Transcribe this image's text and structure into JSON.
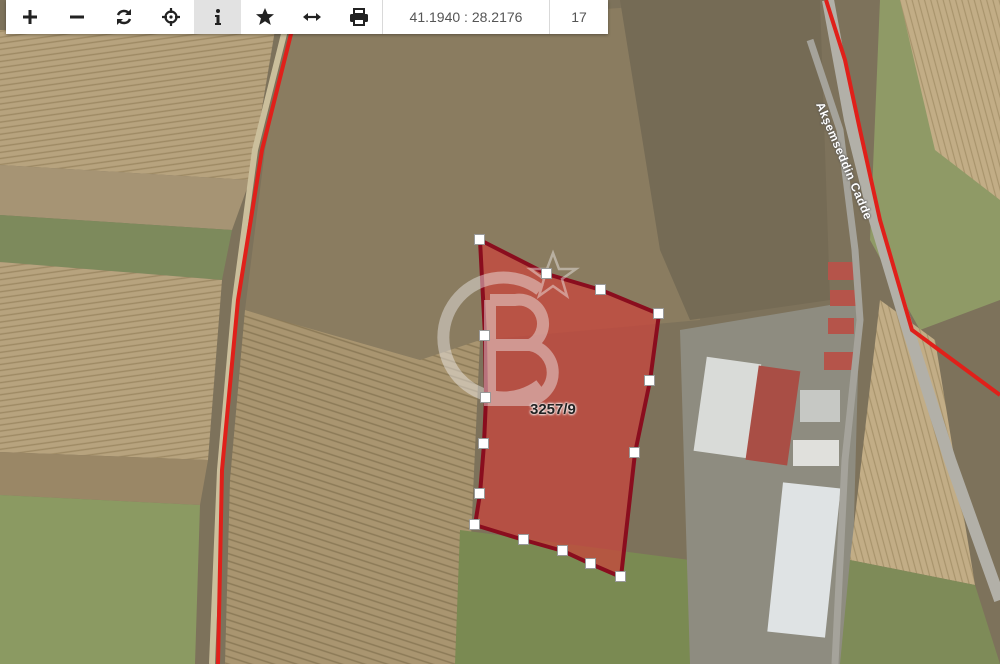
{
  "toolbar": {
    "buttons": [
      {
        "name": "zoom-in",
        "icon": "plus-icon"
      },
      {
        "name": "zoom-out",
        "icon": "minus-icon"
      },
      {
        "name": "refresh",
        "icon": "refresh-icon"
      },
      {
        "name": "locate",
        "icon": "crosshair-icon"
      },
      {
        "name": "info",
        "icon": "info-icon"
      },
      {
        "name": "favorite",
        "icon": "star-icon"
      },
      {
        "name": "measure",
        "icon": "arrows-horizontal-icon"
      },
      {
        "name": "print",
        "icon": "printer-icon"
      }
    ],
    "active_button": "info",
    "coordinates": "41.1940 : 28.2176",
    "zoom_level": "17"
  },
  "map": {
    "basemap": "satellite",
    "parcel_label": "3257/9",
    "street_label": "Akşemseddin Cadde",
    "watermark": "CB",
    "colors": {
      "parcel_fill": "#c8463c",
      "parcel_border": "#8a0d1e",
      "boundary_line": "#e0201a",
      "vertex_handle": "#ffffff"
    }
  }
}
